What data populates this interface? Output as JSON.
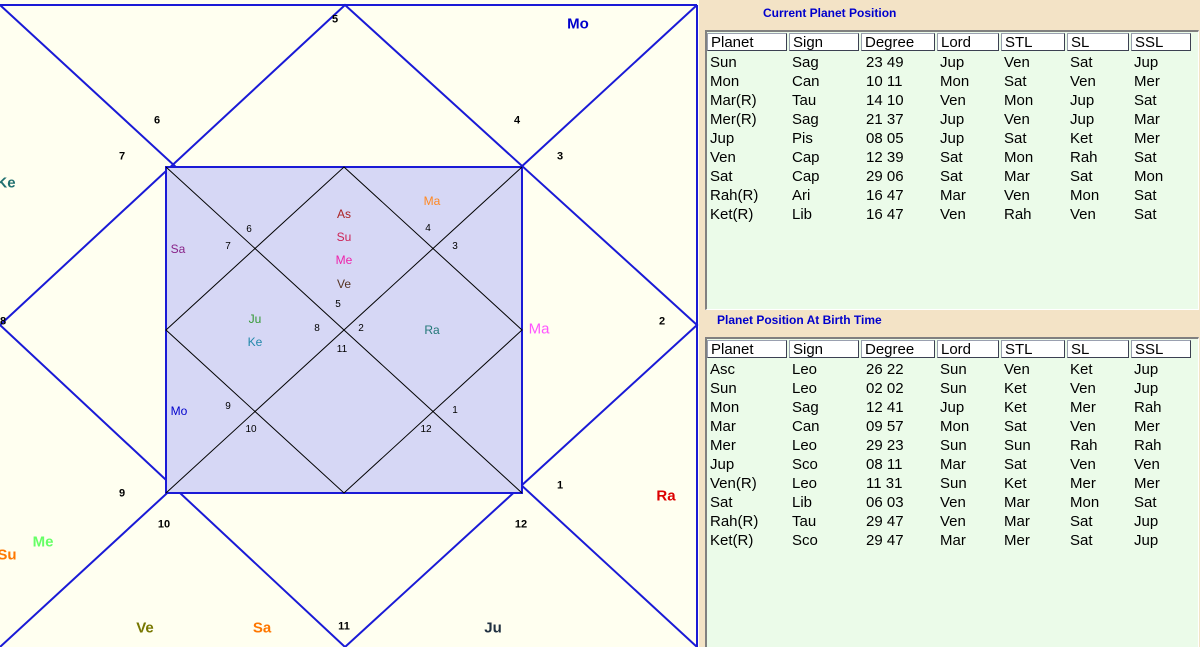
{
  "chart": {
    "outer_house_numbers": [
      "5",
      "6",
      "4",
      "7",
      "3",
      "8",
      "2",
      "9",
      "1",
      "10",
      "12",
      "11"
    ],
    "outer_planets": [
      {
        "label": "Mo",
        "color": "#0000cc"
      },
      {
        "label": "Ke",
        "color": "#207070"
      },
      {
        "label": "Ma",
        "color": "#ff55ff"
      },
      {
        "label": "Ra",
        "color": "#dd0000"
      },
      {
        "label": "Me",
        "color": "#66ff66"
      },
      {
        "label": "Su",
        "color": "#ff7700"
      },
      {
        "label": "Ve",
        "color": "#777700"
      },
      {
        "label": "Sa",
        "color": "#ff7700"
      },
      {
        "label": "Ju",
        "color": "#203040"
      }
    ],
    "inner_house_numbers": [
      "6",
      "4",
      "7",
      "3",
      "5",
      "8",
      "2",
      "11",
      "9",
      "1",
      "10",
      "12"
    ],
    "inner_planets": [
      {
        "label": "As",
        "color": "#aa2222"
      },
      {
        "label": "Su",
        "color": "#cc2255"
      },
      {
        "label": "Me",
        "color": "#ee22aa"
      },
      {
        "label": "Ve",
        "color": "#553322"
      },
      {
        "label": "Ma",
        "color": "#ff8822"
      },
      {
        "label": "Sa",
        "color": "#882288"
      },
      {
        "label": "Ju",
        "color": "#339933"
      },
      {
        "label": "Ke",
        "color": "#2288aa"
      },
      {
        "label": "Ra",
        "color": "#227777"
      },
      {
        "label": "Mo",
        "color": "#0000cc"
      }
    ],
    "colors": {
      "line": "#1a1ad6",
      "inner_line": "#000000",
      "inner_fill": "#d6d7f5",
      "background": "#fffff0"
    }
  },
  "current": {
    "title": "Current Planet Position",
    "headers": [
      "Planet",
      "Sign",
      "Degree",
      "Lord",
      "STL",
      "SL",
      "SSL"
    ],
    "rows": [
      [
        "Sun",
        "Sag",
        "23 49",
        "Jup",
        "Ven",
        "Sat",
        "Jup"
      ],
      [
        "Mon",
        "Can",
        "10 11",
        "Mon",
        "Sat",
        "Ven",
        "Mer"
      ],
      [
        "Mar(R)",
        "Tau",
        "14 10",
        "Ven",
        "Mon",
        "Jup",
        "Sat"
      ],
      [
        "Mer(R)",
        "Sag",
        "21 37",
        "Jup",
        "Ven",
        "Jup",
        "Mar"
      ],
      [
        "Jup",
        "Pis",
        "08 05",
        "Jup",
        "Sat",
        "Ket",
        "Mer"
      ],
      [
        "Ven",
        "Cap",
        "12 39",
        "Sat",
        "Mon",
        "Rah",
        "Sat"
      ],
      [
        "Sat",
        "Cap",
        "29 06",
        "Sat",
        "Mar",
        "Sat",
        "Mon"
      ],
      [
        "Rah(R)",
        "Ari",
        "16 47",
        "Mar",
        "Ven",
        "Mon",
        "Sat"
      ],
      [
        "Ket(R)",
        "Lib",
        "16 47",
        "Ven",
        "Rah",
        "Ven",
        "Sat"
      ]
    ]
  },
  "birth": {
    "title": "Planet Position At Birth Time",
    "headers": [
      "Planet",
      "Sign",
      "Degree",
      "Lord",
      "STL",
      "SL",
      "SSL"
    ],
    "rows": [
      [
        "Asc",
        "Leo",
        "26 22",
        "Sun",
        "Ven",
        "Ket",
        "Jup"
      ],
      [
        "Sun",
        "Leo",
        "02 02",
        "Sun",
        "Ket",
        "Ven",
        "Jup"
      ],
      [
        "Mon",
        "Sag",
        "12 41",
        "Jup",
        "Ket",
        "Mer",
        "Rah"
      ],
      [
        "Mar",
        "Can",
        "09 57",
        "Mon",
        "Sat",
        "Ven",
        "Mer"
      ],
      [
        "Mer",
        "Leo",
        "29 23",
        "Sun",
        "Sun",
        "Rah",
        "Rah"
      ],
      [
        "Jup",
        "Sco",
        "08 11",
        "Mar",
        "Sat",
        "Ven",
        "Ven"
      ],
      [
        "Ven(R)",
        "Leo",
        "11 31",
        "Sun",
        "Ket",
        "Mer",
        "Mer"
      ],
      [
        "Sat",
        "Lib",
        "06 03",
        "Ven",
        "Mar",
        "Mon",
        "Sat"
      ],
      [
        "Rah(R)",
        "Tau",
        "29 47",
        "Ven",
        "Mar",
        "Sat",
        "Jup"
      ],
      [
        "Ket(R)",
        "Sco",
        "29 47",
        "Mar",
        "Mer",
        "Sat",
        "Jup"
      ]
    ]
  }
}
